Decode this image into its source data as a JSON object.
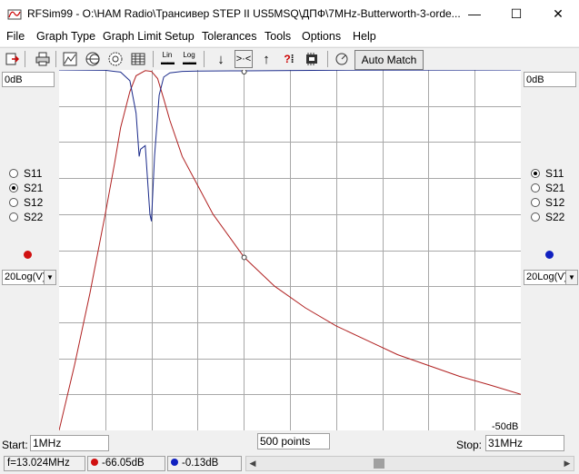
{
  "window": {
    "title": "RFSim99 - O:\\HAM Radio\\Трансивер STEP II US5MSQ\\ДПФ\\7MHz-Butterworth-3-orde...",
    "minimize": "—",
    "maximize": "☐",
    "close": "✕"
  },
  "menu": [
    "File",
    "Graph Type",
    "Graph Limit Setup",
    "Tolerances",
    "Tools",
    "Options",
    "Help"
  ],
  "toolbar": {
    "auto_match": "Auto Match",
    "lin": "Lin",
    "log": "Log"
  },
  "left_panel": {
    "top_label": "0dB",
    "radios": [
      "S11",
      "S21",
      "S12",
      "S22"
    ],
    "selected": "S21",
    "trace_color": "#d01010",
    "scale": "20Log(V)"
  },
  "right_panel": {
    "top_label": "0dB",
    "radios": [
      "S11",
      "S21",
      "S12",
      "S22"
    ],
    "selected": "S11",
    "trace_color": "#1020c0",
    "scale": "20Log(V)"
  },
  "graph": {
    "bottom_right_label": "-50dB",
    "x_divisions": 10,
    "y_divisions": 10
  },
  "chart_data": {
    "type": "line",
    "xlabel": "",
    "ylabel": "",
    "xlim": [
      1,
      31
    ],
    "ylim": [
      -50,
      0
    ],
    "series": [
      {
        "color": "#b02020",
        "x": [
          1,
          2,
          3,
          4,
          4.6,
          5,
          5.6,
          6,
          6.6,
          7,
          7.4,
          7.8,
          8.2,
          9,
          10,
          11,
          13.024,
          15,
          17,
          19,
          21,
          23,
          25,
          27,
          29,
          31
        ],
        "y": [
          -50,
          -41,
          -31,
          -20,
          -13,
          -8,
          -3,
          -0.8,
          -0.1,
          -0.2,
          -1.2,
          -4,
          -7,
          -12,
          -16,
          -20,
          -26,
          -30,
          -33,
          -35.5,
          -37.5,
          -39.5,
          -41,
          -42.5,
          -43.7,
          -45
        ]
      },
      {
        "color": "#1a2a8a",
        "x": [
          1,
          4,
          5,
          5.6,
          6,
          6.2,
          6.3,
          6.6,
          6.9,
          7,
          7.2,
          7.5,
          7.8,
          8.2,
          9,
          10,
          13.024,
          20,
          31
        ],
        "y": [
          0,
          -0.05,
          -0.3,
          -1.5,
          -6,
          -12,
          -11,
          -10.5,
          -20,
          -21,
          -12,
          -3.5,
          -1,
          -0.4,
          -0.2,
          -0.15,
          -0.13,
          -0.02,
          0
        ]
      }
    ],
    "marker": {
      "x": 13.024
    }
  },
  "bottom": {
    "start_label": "Start:",
    "start_value": "1MHz",
    "points_value": "500 points",
    "stop_label": "Stop:",
    "stop_value": "31MHz"
  },
  "status": {
    "freq": "f=13.024MHz",
    "s21_value": "-66.05dB",
    "s11_value": "-0.13dB"
  }
}
